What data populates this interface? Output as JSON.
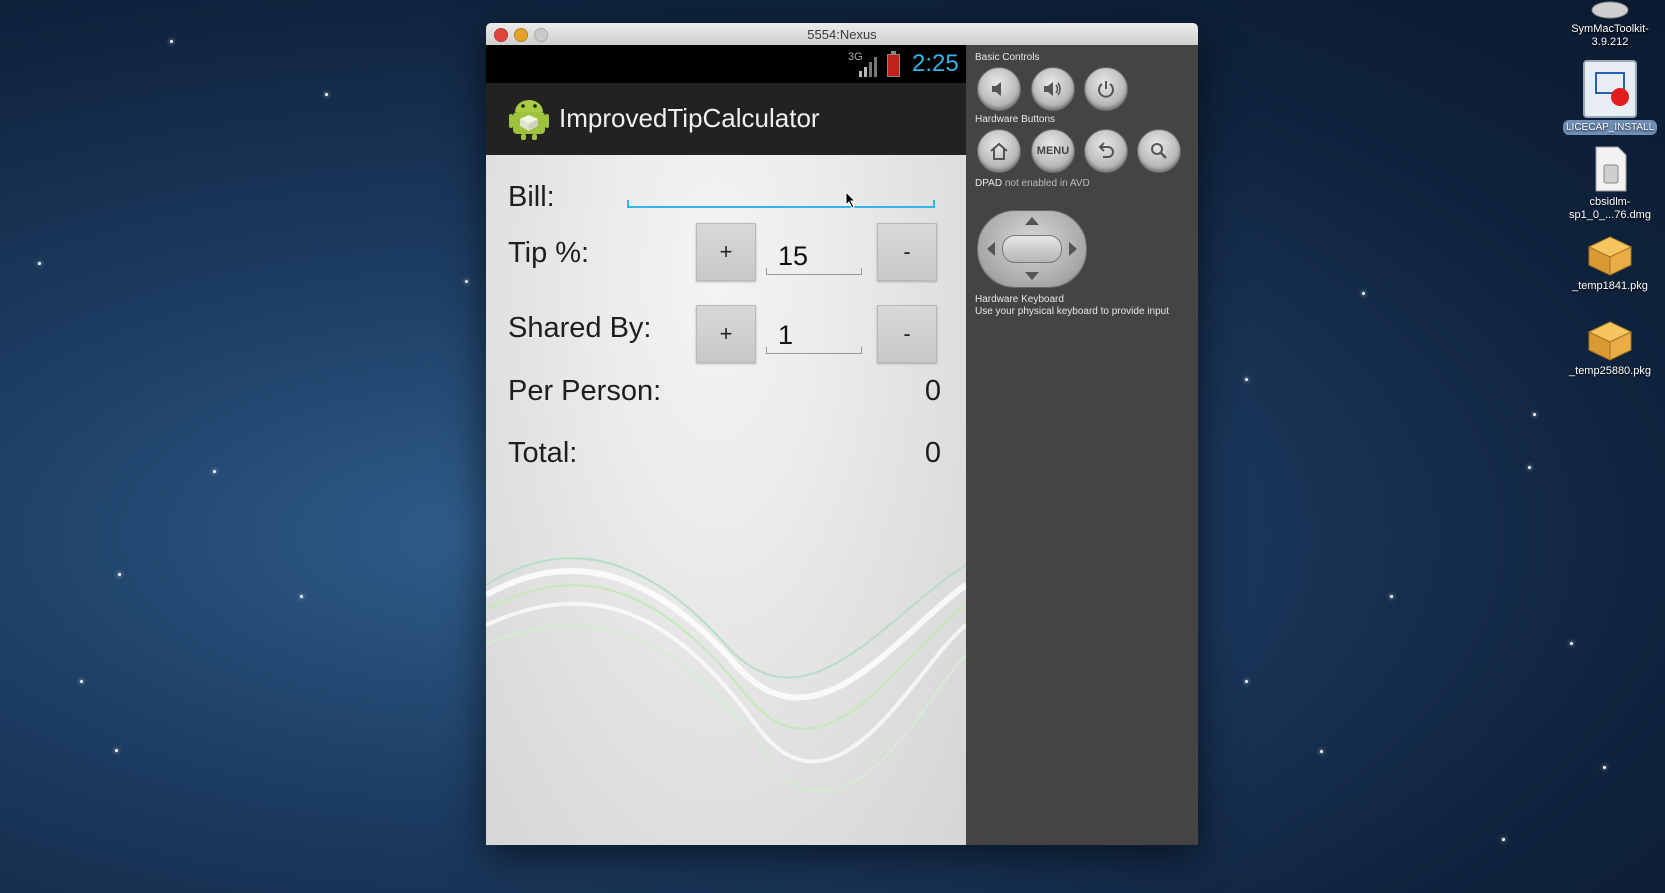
{
  "window": {
    "title": "5554:Nexus"
  },
  "status_bar": {
    "network": "3G",
    "time": "2:25"
  },
  "app": {
    "title": "ImprovedTipCalculator"
  },
  "form": {
    "bill_label": "Bill:",
    "bill_value": "",
    "tip_label": "Tip %:",
    "tip_plus": "+",
    "tip_value": "15",
    "tip_minus": "-",
    "shared_label": "Shared By:",
    "shared_plus": "+",
    "shared_value": "1",
    "shared_minus": "-",
    "per_person_label": "Per Person:",
    "per_person_value": "0",
    "total_label": "Total:",
    "total_value": "0"
  },
  "panel": {
    "basic_controls": "Basic Controls",
    "hardware_buttons": "Hardware Buttons",
    "menu_label": "MENU",
    "dpad_label": "DPAD",
    "dpad_note": "not enabled in AVD",
    "keyboard_title": "Hardware Keyboard",
    "keyboard_note": "Use your physical keyboard to provide input"
  },
  "desktop_icons": [
    {
      "label": "SymMacToolkit-3.9.212",
      "icon": "disk-image-icon"
    },
    {
      "label": "LICECAP_INSTALL",
      "icon": "licecap-icon"
    },
    {
      "label": "cbsidlm-sp1_0_...76.dmg",
      "icon": "dmg-file-icon"
    },
    {
      "label": "_temp1841.pkg",
      "icon": "package-icon"
    },
    {
      "label": "_temp25880.pkg",
      "icon": "package-icon"
    }
  ],
  "colors": {
    "accent": "#33b5e5",
    "action_bar": "#222222",
    "panel": "#444444"
  }
}
